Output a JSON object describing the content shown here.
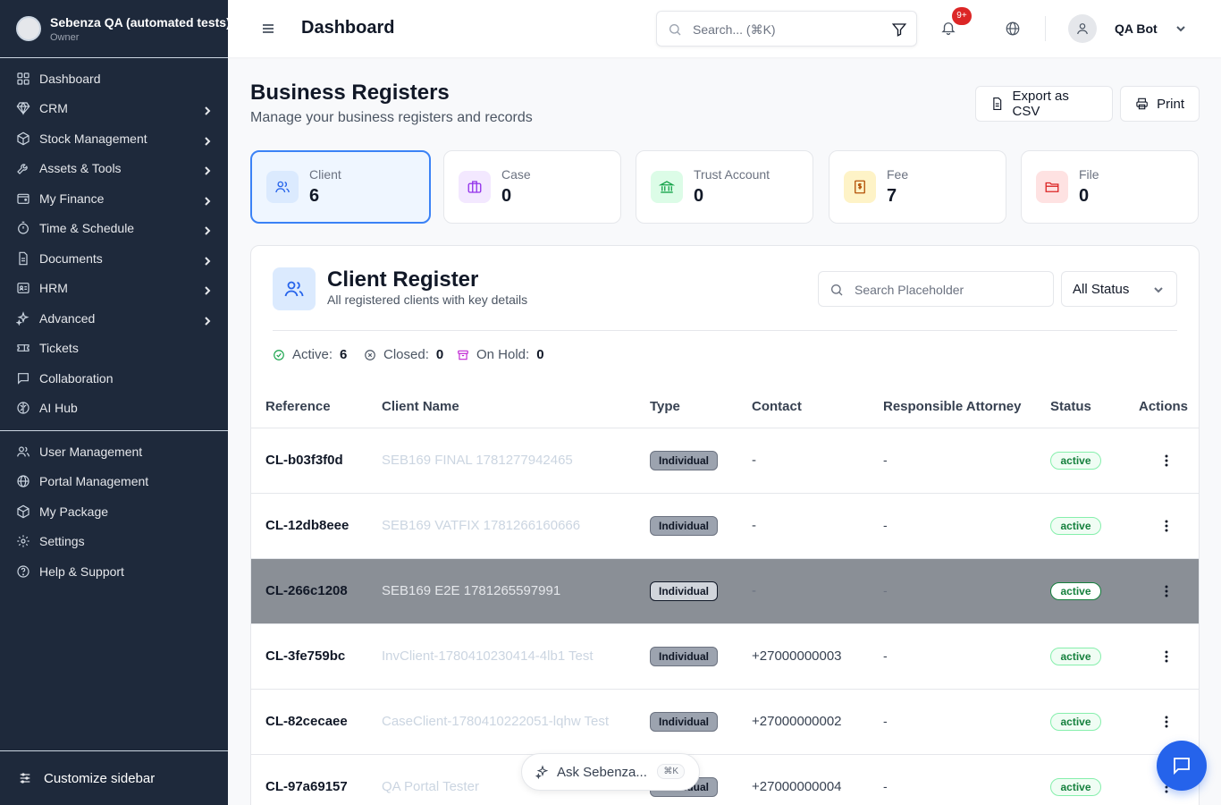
{
  "org": {
    "name": "Sebenza QA (automated tests)",
    "role": "Owner"
  },
  "sidebar": {
    "items": [
      {
        "label": "Dashboard",
        "icon": "dashboard-icon",
        "chevron": false
      },
      {
        "label": "CRM",
        "icon": "gem-icon",
        "chevron": true
      },
      {
        "label": "Stock Management",
        "icon": "package-icon",
        "chevron": true
      },
      {
        "label": "Assets & Tools",
        "icon": "wrench-icon",
        "chevron": true
      },
      {
        "label": "My Finance",
        "icon": "wallet-icon",
        "chevron": true
      },
      {
        "label": "Time & Schedule",
        "icon": "timer-icon",
        "chevron": true
      },
      {
        "label": "Documents",
        "icon": "document-icon",
        "chevron": true
      },
      {
        "label": "HRM",
        "icon": "id-card-icon",
        "chevron": true
      },
      {
        "label": "Advanced",
        "icon": "sparkles-icon",
        "chevron": true
      },
      {
        "label": "Tickets",
        "icon": "ticket-icon",
        "chevron": false
      },
      {
        "label": "Collaboration",
        "icon": "chat-icon",
        "chevron": false
      },
      {
        "label": "AI Hub",
        "icon": "brain-icon",
        "chevron": false
      }
    ],
    "bottom_items": [
      {
        "label": "User Management",
        "icon": "users-icon"
      },
      {
        "label": "Portal Management",
        "icon": "globe-icon"
      },
      {
        "label": "My Package",
        "icon": "package-icon"
      },
      {
        "label": "Settings",
        "icon": "gear-icon"
      },
      {
        "label": "Help & Support",
        "icon": "help-icon"
      }
    ],
    "customize_label": "Customize sidebar"
  },
  "header": {
    "title": "Dashboard",
    "search_placeholder": "Search... (⌘K)",
    "notif_badge": "9+",
    "user_name": "QA Bot"
  },
  "page": {
    "title": "Business Registers",
    "subtitle": "Manage your business registers and records",
    "export_label": "Export as CSV",
    "print_label": "Print"
  },
  "stats": [
    {
      "label": "Client",
      "value": "6",
      "icon": "users-icon",
      "color": "#2563eb",
      "bg": "#dbeafe"
    },
    {
      "label": "Case",
      "value": "0",
      "icon": "briefcase-icon",
      "color": "#9333ea",
      "bg": "#f3e8ff"
    },
    {
      "label": "Trust Account",
      "value": "0",
      "icon": "bank-icon",
      "color": "#16a34a",
      "bg": "#dcfce7"
    },
    {
      "label": "Fee",
      "value": "7",
      "icon": "receipt-dollar-icon",
      "color": "#b45309",
      "bg": "#fef3c7"
    },
    {
      "label": "File",
      "value": "0",
      "icon": "folder-icon",
      "color": "#dc2626",
      "bg": "#fee2e2"
    }
  ],
  "register": {
    "title": "Client Register",
    "subtitle": "All registered clients with key details",
    "search_placeholder": "Search Placeholder",
    "status_filter": "All Status",
    "summary": {
      "active_label": "Active:",
      "active_value": "6",
      "closed_label": "Closed:",
      "closed_value": "0",
      "onhold_label": "On Hold:",
      "onhold_value": "0"
    },
    "columns": [
      "Reference",
      "Client Name",
      "Type",
      "Contact",
      "Responsible Attorney",
      "Status",
      "Actions"
    ],
    "rows": [
      {
        "ref": "CL-b03f3f0d",
        "name": "SEB169 FINAL 1781277942465",
        "type": "Individual",
        "contact": "-",
        "attorney": "-",
        "status": "active"
      },
      {
        "ref": "CL-12db8eee",
        "name": "SEB169 VATFIX 1781266160666",
        "type": "Individual",
        "contact": "-",
        "attorney": "-",
        "status": "active"
      },
      {
        "ref": "CL-266c1208",
        "name": "SEB169 E2E 1781265597991",
        "type": "Individual",
        "contact": "-",
        "attorney": "-",
        "status": "active"
      },
      {
        "ref": "CL-3fe759bc",
        "name": "InvClient-1780410230414-4lb1 Test",
        "type": "Individual",
        "contact": "+27000000003",
        "attorney": "-",
        "status": "active"
      },
      {
        "ref": "CL-82cecaee",
        "name": "CaseClient-1780410222051-lqhw Test",
        "type": "Individual",
        "contact": "+27000000002",
        "attorney": "-",
        "status": "active"
      },
      {
        "ref": "CL-97a69157",
        "name": "QA Portal Tester",
        "type": "Individual",
        "contact": "+27000000004",
        "attorney": "-",
        "status": "active"
      }
    ]
  },
  "ask": {
    "label": "Ask Sebenza...",
    "shortcut": "⌘K"
  }
}
